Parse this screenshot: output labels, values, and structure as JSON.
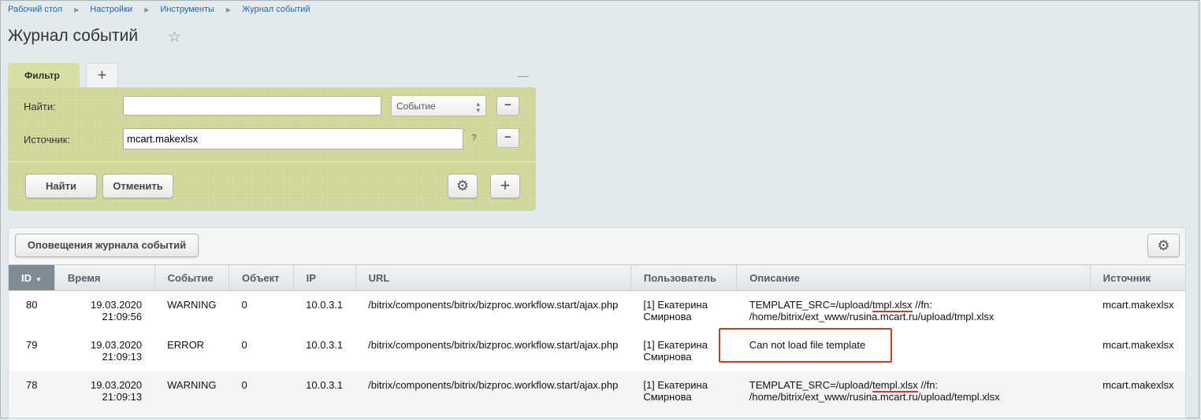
{
  "breadcrumb": [
    "Рабочий стол",
    "Настройки",
    "Инструменты",
    "Журнал событий"
  ],
  "page_title": "Журнал событий",
  "filter": {
    "tab_label": "Фильтр",
    "add_tab": "+",
    "collapse": "—",
    "find_label": "Найти:",
    "find_value": "",
    "find_select": "Событие",
    "source_label": "Источник:",
    "source_value": "mcart.makexlsx",
    "help": "?",
    "find_button": "Найти",
    "cancel_button": "Отменить"
  },
  "grid": {
    "toolbar_button": "Оповещения журнала событий",
    "columns": [
      "ID",
      "Время",
      "Событие",
      "Объект",
      "IP",
      "URL",
      "Пользователь",
      "Описание",
      "Источник"
    ],
    "rows": [
      {
        "id": "80",
        "date": "19.03.2020",
        "time": "21:09:56",
        "event": "WARNING",
        "object": "0",
        "ip": "10.0.3.1",
        "url": "/bitrix/components/bitrix/bizproc.workflow.start/ajax.php",
        "user_line1": "[1] Екатерина",
        "user_line2": "Смирнова",
        "desc_pre": "TEMPLATE_SRC=/upload/",
        "desc_mark": "tmpl.xlsx",
        "desc_post": " //fn:",
        "desc_line2": "/home/bitrix/ext_www/rusina.mcart.ru/upload/tmpl.xlsx",
        "source": "mcart.makexlsx"
      },
      {
        "id": "79",
        "date": "19.03.2020",
        "time": "21:09:13",
        "event": "ERROR",
        "object": "0",
        "ip": "10.0.3.1",
        "url": "/bitrix/components/bitrix/bizproc.workflow.start/ajax.php",
        "user_line1": "[1] Екатерина",
        "user_line2": "Смирнова",
        "desc": "Can not load file template",
        "source": "mcart.makexlsx"
      },
      {
        "id": "78",
        "date": "19.03.2020",
        "time": "21:09:13",
        "event": "WARNING",
        "object": "0",
        "ip": "10.0.3.1",
        "url": "/bitrix/components/bitrix/bizproc.workflow.start/ajax.php",
        "user_line1": "[1] Екатерина",
        "user_line2": "Смирнова",
        "desc_pre": "TEMPLATE_SRC=/upload/",
        "desc_mark": "templ.xlsx",
        "desc_post": " //fn:",
        "desc_line2": "/home/bitrix/ext_www/rusina.mcart.ru/upload/templ.xlsx",
        "source": "mcart.makexlsx"
      }
    ]
  },
  "colors": {
    "background": "#e2eaed",
    "filter_bg": "#d5dc9e",
    "link": "#2067b0",
    "sorted_header": "#7e8c97",
    "highlight": "#c2411e"
  }
}
